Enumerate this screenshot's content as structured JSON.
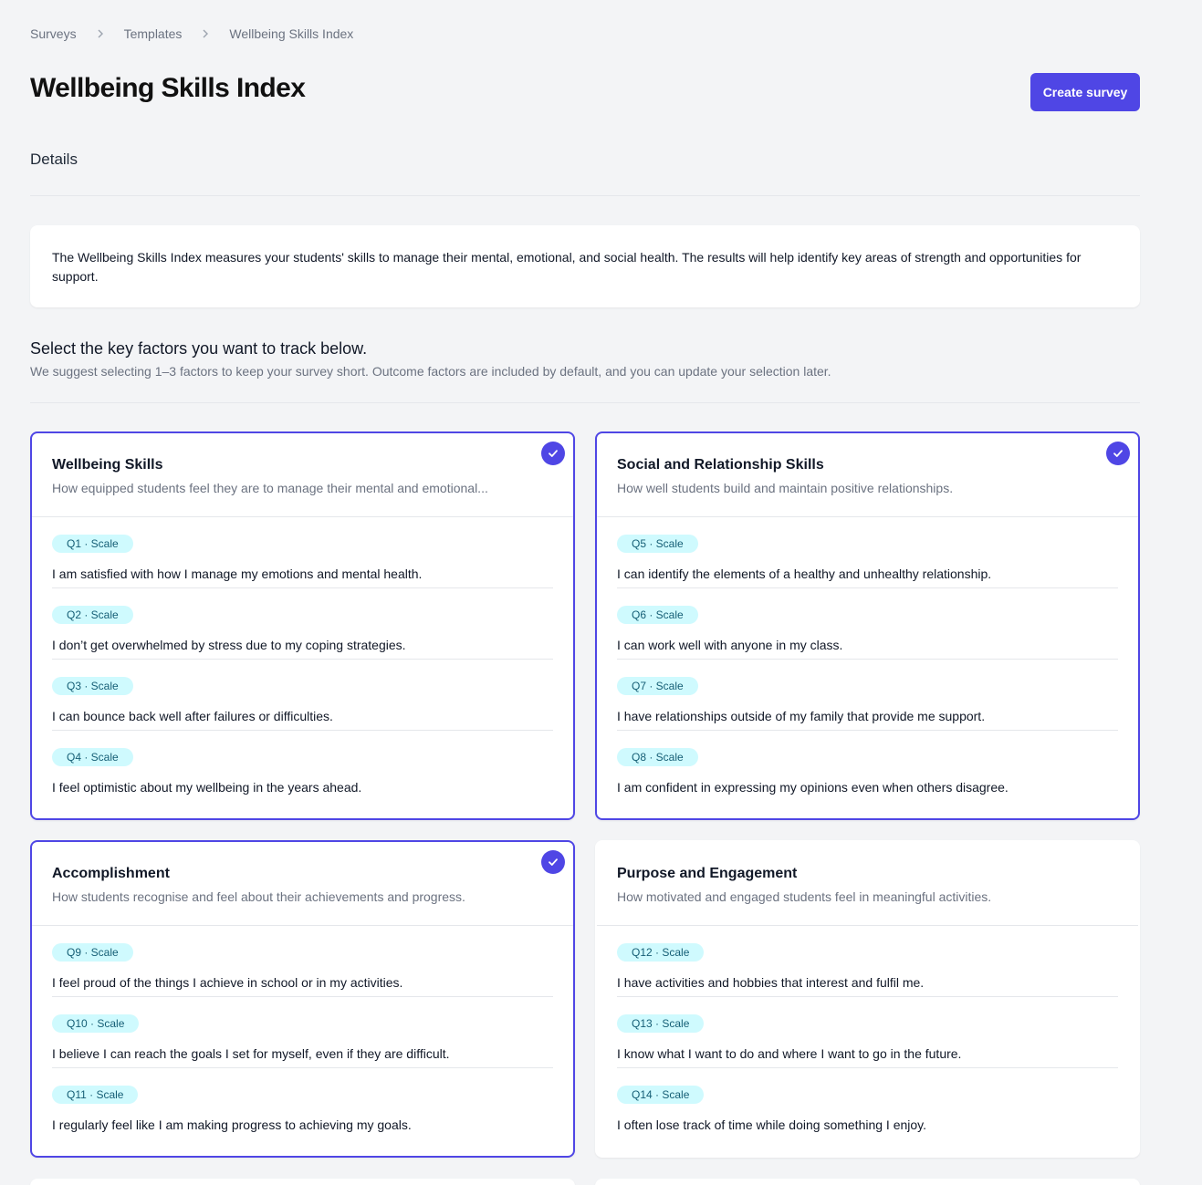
{
  "breadcrumb": [
    "Surveys",
    "Templates",
    "Wellbeing Skills Index"
  ],
  "title": "Wellbeing Skills Index",
  "create_button": "Create survey",
  "details_label": "Details",
  "description": "The Wellbeing Skills Index measures your students' skills to manage their mental, emotional, and social health. The results will help identify key areas of strength and opportunities for support.",
  "select": {
    "title": "Select the key factors you want to track below.",
    "subtitle": "We suggest selecting 1–3 factors to keep your survey short. Outcome factors are included by default, and you can update your selection later."
  },
  "factors": [
    {
      "title": "Wellbeing Skills",
      "description": "How equipped students feel they are to manage their mental and emotional...",
      "selected": true,
      "questions": [
        {
          "tag": "Q1 · Scale",
          "text": "I am satisfied with how I manage my emotions and mental health."
        },
        {
          "tag": "Q2 · Scale",
          "text": "I don’t get overwhelmed by stress due to my coping strategies."
        },
        {
          "tag": "Q3 · Scale",
          "text": "I can bounce back well after failures or difficulties."
        },
        {
          "tag": "Q4 · Scale",
          "text": "I feel optimistic about my wellbeing in the years ahead."
        }
      ]
    },
    {
      "title": "Social and Relationship Skills",
      "description": "How well students build and maintain positive relationships.",
      "selected": true,
      "questions": [
        {
          "tag": "Q5 · Scale",
          "text": "I can identify the elements of a healthy and unhealthy relationship."
        },
        {
          "tag": "Q6 · Scale",
          "text": "I can work well with anyone in my class."
        },
        {
          "tag": "Q7 · Scale",
          "text": "I have relationships outside of my family that provide me support."
        },
        {
          "tag": "Q8 · Scale",
          "text": "I am confident in expressing my opinions even when others disagree."
        }
      ]
    },
    {
      "title": "Accomplishment",
      "description": "How students recognise and feel about their achievements and progress.",
      "selected": true,
      "questions": [
        {
          "tag": "Q9 · Scale",
          "text": "I feel proud of the things I achieve in school or in my activities."
        },
        {
          "tag": "Q10 · Scale",
          "text": "I believe I can reach the goals I set for myself, even if they are difficult."
        },
        {
          "tag": "Q11 · Scale",
          "text": "I regularly feel like I am making progress to achieving my goals."
        }
      ]
    },
    {
      "title": "Purpose and Engagement",
      "description": "How motivated and engaged students feel in meaningful activities.",
      "selected": false,
      "questions": [
        {
          "tag": "Q12 · Scale",
          "text": "I have activities and hobbies that interest and fulfil me."
        },
        {
          "tag": "Q13 · Scale",
          "text": "I know what I want to do and where I want to go in the future."
        },
        {
          "tag": "Q14 · Scale",
          "text": "I often lose track of time while doing something I enjoy."
        }
      ]
    }
  ],
  "colors": {
    "accent": "#4f46e5",
    "tag_bg": "#cffafe",
    "tag_text": "#155e75",
    "background": "#f3f4f6"
  },
  "icons": {
    "breadcrumb_separator": "chevron-right-icon",
    "selected_marker": "check-circle-icon"
  }
}
